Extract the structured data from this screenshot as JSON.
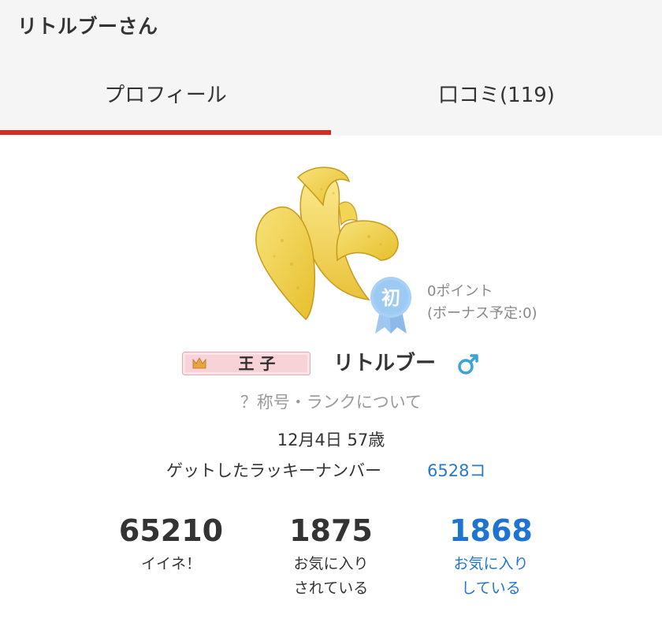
{
  "header": {
    "title": "リトルブーさん"
  },
  "tabs": [
    {
      "label": "プロフィール",
      "active": true
    },
    {
      "label": "口コミ(119)",
      "active": false
    }
  ],
  "colors": {
    "accent": "#d32a22",
    "link": "#2a78c8",
    "stat_blue": "#1f74d2",
    "gender": "#3aa3d8"
  },
  "profile": {
    "avatar_icon": "peeled-banana-image",
    "rank_badge": "初",
    "points": "0ポイント",
    "bonus": "(ボーナス予定:0)",
    "title_badge": "王 子",
    "name": "リトルブー",
    "gender_icon": "male-icon",
    "rank_link": "？称号・ランクについて",
    "birthday": "12月4日 57歳",
    "lucky_label": "ゲットしたラッキーナンバー",
    "lucky_count": "6528コ"
  },
  "stats": [
    {
      "value": "65210",
      "label_line1": "イイネ！",
      "label_line2": ""
    },
    {
      "value": "1875",
      "label_line1": "お気に入り",
      "label_line2": "されている"
    },
    {
      "value": "1868",
      "label_line1": "お気に入り",
      "label_line2": "している"
    }
  ]
}
